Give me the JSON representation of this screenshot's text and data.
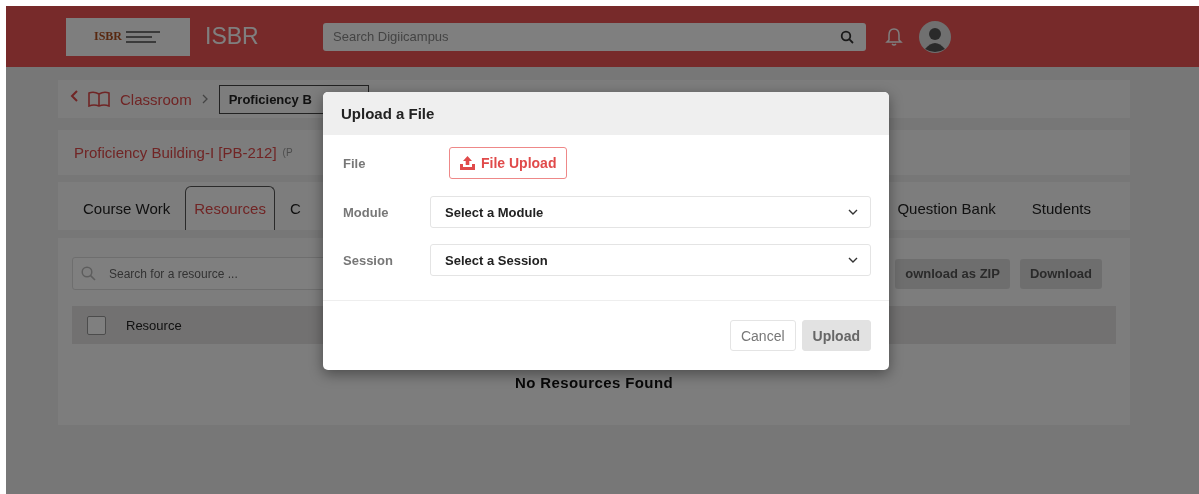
{
  "header": {
    "logo": {
      "mark": "ISBR"
    },
    "brand": "ISBR",
    "search": {
      "placeholder": "Search Digiicampus"
    }
  },
  "breadcrumb": {
    "items": [
      {
        "label": "Classroom"
      }
    ],
    "current": "Proficiency B"
  },
  "course": {
    "title": "Proficiency Building-I [PB-212]",
    "subtitle": "(P"
  },
  "tabs": {
    "left": [
      {
        "label": "Course Work",
        "selected": false
      },
      {
        "label": "Resources",
        "selected": true
      },
      {
        "label": "C",
        "selected": false
      }
    ],
    "right": [
      {
        "label": "Question Bank",
        "selected": false
      },
      {
        "label": "Students",
        "selected": false
      }
    ]
  },
  "resources": {
    "search": {
      "placeholder": "Search for a resource ..."
    },
    "buttons": [
      "ownload as ZIP",
      "Download"
    ],
    "table": {
      "checked": false,
      "columns": [
        "Resource"
      ]
    },
    "empty": "No Resources Found"
  },
  "dialog": {
    "title": "Upload a File",
    "fields": [
      {
        "kind": "file",
        "label": "File",
        "button": "File Upload"
      },
      {
        "kind": "select",
        "label": "Module",
        "value": "Select a Module"
      },
      {
        "kind": "select",
        "label": "Session",
        "value": "Select a Session"
      }
    ],
    "buttons": [
      {
        "label": "Cancel",
        "disabled": false
      },
      {
        "label": "Upload",
        "disabled": true
      }
    ]
  }
}
